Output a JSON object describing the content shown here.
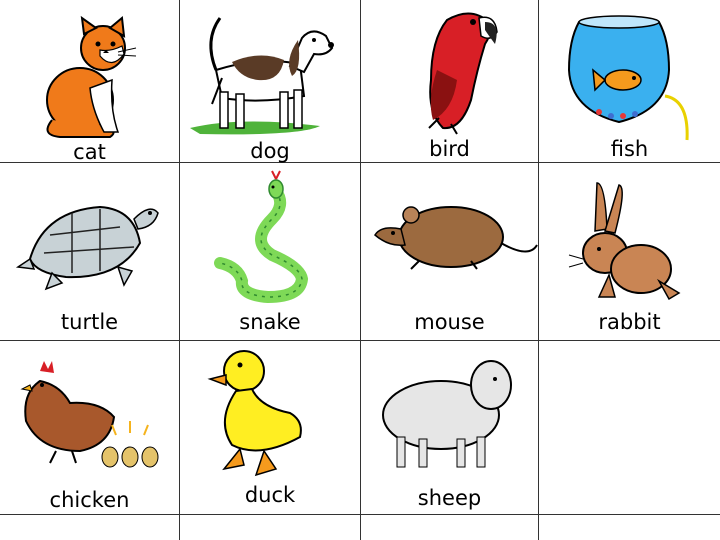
{
  "animals": [
    {
      "label": "cat"
    },
    {
      "label": "dog"
    },
    {
      "label": "bird"
    },
    {
      "label": "fish"
    },
    {
      "label": "turtle"
    },
    {
      "label": "snake"
    },
    {
      "label": "mouse"
    },
    {
      "label": "rabbit"
    },
    {
      "label": "chicken"
    },
    {
      "label": "duck"
    },
    {
      "label": "sheep"
    }
  ],
  "colors": {
    "grid": "#333333",
    "background": "#ffffff",
    "cat": "#f07a1a",
    "bird": "#d81f26",
    "fish_bowl": "#3ab0ef",
    "fish": "#f59a1d",
    "snake": "#7ed957",
    "duck": "#ffee22",
    "chicken": "#a8582c"
  }
}
